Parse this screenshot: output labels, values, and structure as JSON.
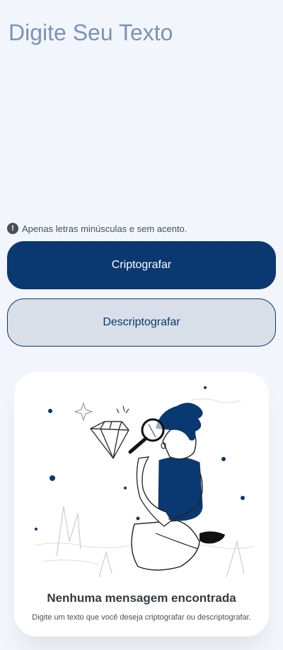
{
  "input": {
    "placeholder": "Digite Seu Texto"
  },
  "hint": {
    "text": "Apenas letras minúsculas e sem acento."
  },
  "buttons": {
    "encrypt": "Criptografar",
    "decrypt": "Descriptografar"
  },
  "output": {
    "title": "Nenhuma mensagem encontrada",
    "description": "Digite um texto que você deseja criptografar ou descriptografar."
  },
  "colors": {
    "background": "#f3f5fc",
    "primary": "#0a3871",
    "secondary_button": "#d8dfe8",
    "placeholder": "#7b93b6",
    "card": "#ffffff"
  },
  "icons": [
    "exclamation-icon",
    "magnifier-person-illustration"
  ]
}
